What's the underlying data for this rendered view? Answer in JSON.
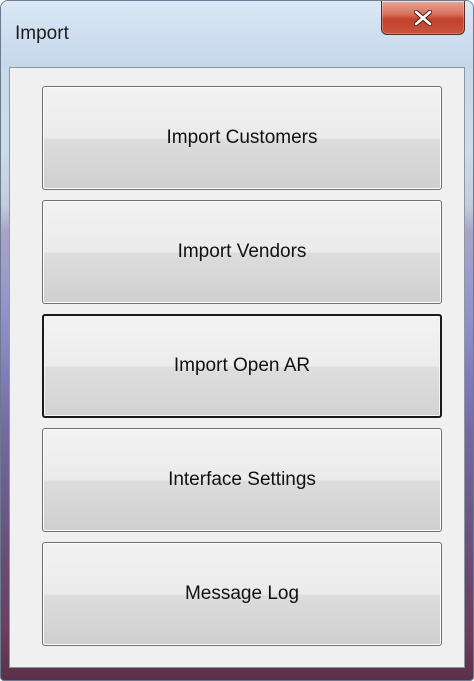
{
  "window": {
    "title": "Import",
    "close_icon": "close-x-icon"
  },
  "buttons": [
    {
      "label": "Import Customers"
    },
    {
      "label": "Import Vendors"
    },
    {
      "label": "Import Open AR",
      "focused": true
    },
    {
      "label": "Interface Settings"
    },
    {
      "label": "Message Log"
    }
  ],
  "colors": {
    "close_button": "#c2412b",
    "client_background": "#f0f0f0"
  }
}
